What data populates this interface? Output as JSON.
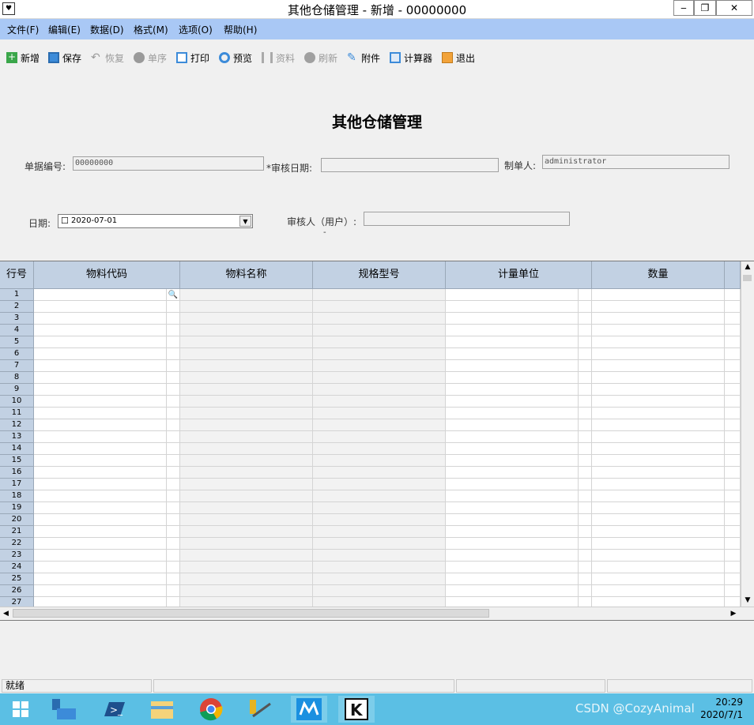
{
  "window": {
    "title": "其他仓储管理 - 新增 - 00000000",
    "app_icon_glyph": "♥",
    "min_glyph": "‒",
    "max_glyph": "❐",
    "close_glyph": "✕"
  },
  "menu": [
    "文件(F)",
    "编辑(E)",
    "数据(D)",
    "格式(M)",
    "选项(O)",
    "帮助(H)"
  ],
  "toolbar": [
    {
      "label": "新增",
      "icon": "add-icon",
      "enabled": true
    },
    {
      "label": "保存",
      "icon": "save-icon",
      "enabled": true
    },
    {
      "label": "恢复",
      "icon": "undo-icon",
      "enabled": false
    },
    {
      "label": "单序",
      "icon": "sort-icon",
      "enabled": false
    },
    {
      "label": "打印",
      "icon": "print-icon",
      "enabled": true
    },
    {
      "label": "预览",
      "icon": "preview-icon",
      "enabled": true
    },
    {
      "label": "资料",
      "icon": "books-icon",
      "enabled": false
    },
    {
      "label": "刷新",
      "icon": "refresh-icon",
      "enabled": false
    },
    {
      "label": "附件",
      "icon": "paperclip-icon",
      "enabled": true
    },
    {
      "label": "计算器",
      "icon": "calculator-icon",
      "enabled": true
    },
    {
      "label": "退出",
      "icon": "exit-icon",
      "enabled": true
    }
  ],
  "form": {
    "title": "其他仓储管理",
    "doc_no_label": "单据编号:",
    "doc_no_value": "00000000",
    "audit_date_label": "*审核日期:",
    "audit_date_value": "",
    "maker_label": "制单人:",
    "maker_value": "administrator",
    "date_label": "日期:",
    "date_value": "2020-07-01",
    "checkbox_glyph": "☐",
    "dropdown_glyph": "▼",
    "auditor_label": "审核人（用户）:",
    "auditor_value": "",
    "auditor_dash": "-"
  },
  "grid": {
    "row_header": "行号",
    "columns": [
      "物料代码",
      "物料名称",
      "规格型号",
      "计量单位",
      "数量"
    ],
    "rows": [
      "1",
      "2",
      "3",
      "4",
      "5",
      "6",
      "7",
      "8",
      "9",
      "10",
      "11",
      "12",
      "13",
      "14",
      "15",
      "16",
      "17",
      "18",
      "19",
      "20",
      "21",
      "22",
      "23",
      "24",
      "25",
      "26",
      "27"
    ],
    "lookup_glyph": "🔍",
    "scroll_up": "▲",
    "scroll_down": "▼",
    "scroll_left": "◀",
    "scroll_right": "▶"
  },
  "status": {
    "text": "就绪"
  },
  "taskbar": {
    "time": "20:29",
    "date": "2020/7/1",
    "watermark": "CSDN @CozyAnimal"
  },
  "colors": {
    "menubar": "#a9c8f5",
    "grid_header": "#c2d1e3",
    "taskbar": "#5bbfe4"
  }
}
